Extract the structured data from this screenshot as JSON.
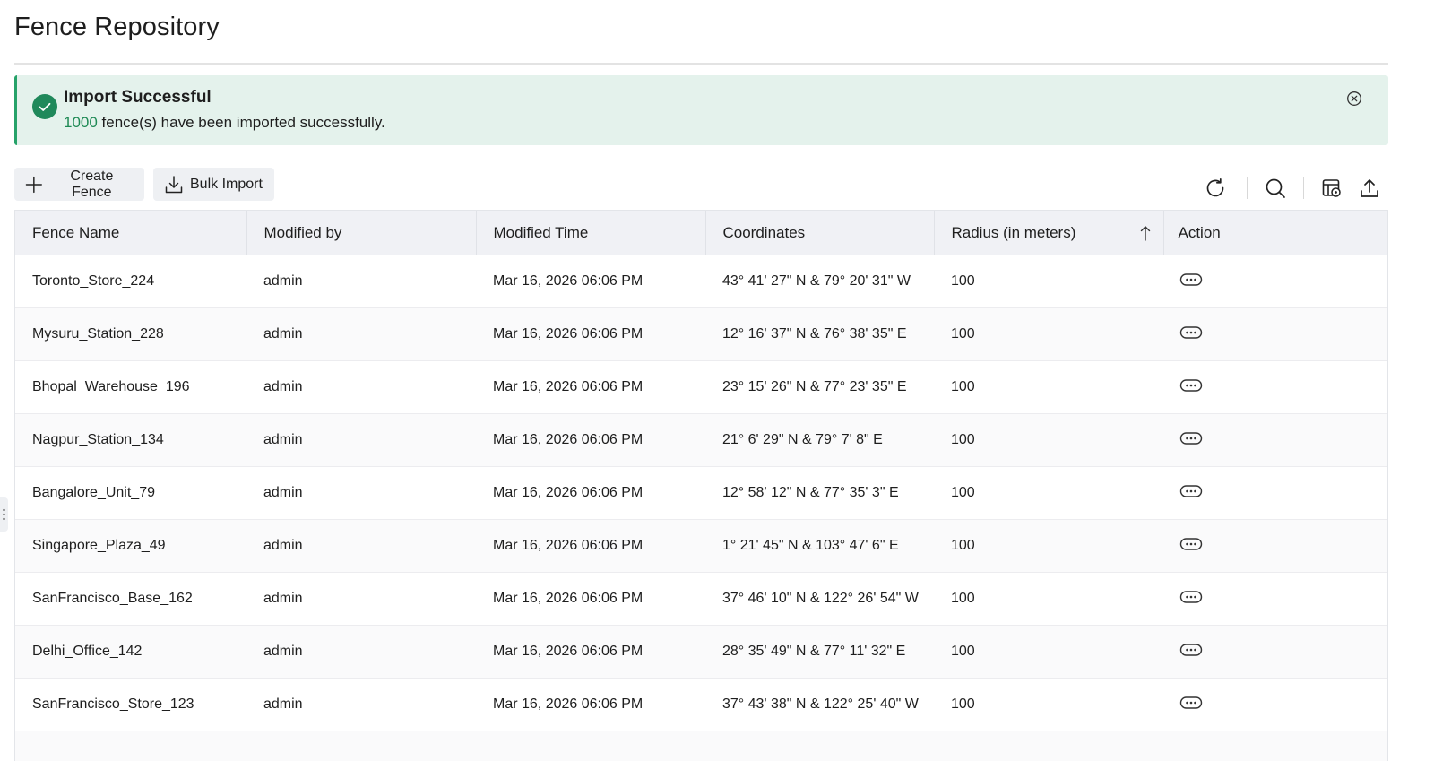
{
  "page": {
    "title": "Fence Repository"
  },
  "banner": {
    "title": "Import Successful",
    "count": "1000",
    "message": " fence(s) have been imported successfully.",
    "icon": "check-circle-icon",
    "close_icon": "close-circle-icon"
  },
  "toolbar": {
    "create_label": "Create Fence",
    "import_label": "Bulk Import",
    "icons": [
      "refresh-icon",
      "search-icon",
      "table-settings-icon",
      "export-icon"
    ]
  },
  "table": {
    "columns": [
      "Fence Name",
      "Modified by",
      "Modified Time",
      "Coordinates",
      "Radius (in meters)",
      "Action"
    ],
    "sorted_column": "Radius (in meters)",
    "sort_direction": "ascending",
    "rows": [
      {
        "name": "Toronto_Store_224",
        "modified_by": "admin",
        "modified_time": "Mar 16, 2026 06:06 PM",
        "coordinates": "43° 41' 27\" N & 79° 20' 31\" W",
        "radius": "100"
      },
      {
        "name": "Mysuru_Station_228",
        "modified_by": "admin",
        "modified_time": "Mar 16, 2026 06:06 PM",
        "coordinates": "12° 16' 37\" N & 76° 38' 35\" E",
        "radius": "100"
      },
      {
        "name": "Bhopal_Warehouse_196",
        "modified_by": "admin",
        "modified_time": "Mar 16, 2026 06:06 PM",
        "coordinates": "23° 15' 26\" N & 77° 23' 35\" E",
        "radius": "100"
      },
      {
        "name": "Nagpur_Station_134",
        "modified_by": "admin",
        "modified_time": "Mar 16, 2026 06:06 PM",
        "coordinates": "21° 6' 29\" N & 79° 7' 8\" E",
        "radius": "100"
      },
      {
        "name": "Bangalore_Unit_79",
        "modified_by": "admin",
        "modified_time": "Mar 16, 2026 06:06 PM",
        "coordinates": "12° 58' 12\" N & 77° 35' 3\" E",
        "radius": "100"
      },
      {
        "name": "Singapore_Plaza_49",
        "modified_by": "admin",
        "modified_time": "Mar 16, 2026 06:06 PM",
        "coordinates": "1° 21' 45\" N & 103° 47' 6\" E",
        "radius": "100"
      },
      {
        "name": "SanFrancisco_Base_162",
        "modified_by": "admin",
        "modified_time": "Mar 16, 2026 06:06 PM",
        "coordinates": "37° 46' 10\" N & 122° 26' 54\" W",
        "radius": "100"
      },
      {
        "name": "Delhi_Office_142",
        "modified_by": "admin",
        "modified_time": "Mar 16, 2026 06:06 PM",
        "coordinates": "28° 35' 49\" N & 77° 11' 32\" E",
        "radius": "100"
      },
      {
        "name": "SanFrancisco_Store_123",
        "modified_by": "admin",
        "modified_time": "Mar 16, 2026 06:06 PM",
        "coordinates": "37° 43' 38\" N & 122° 25' 40\" W",
        "radius": "100"
      },
      {
        "name": "",
        "modified_by": "",
        "modified_time": "",
        "coordinates": "",
        "radius": ""
      }
    ],
    "action_icon": "more-options-icon"
  },
  "colors": {
    "success_bg": "#e4f2ec",
    "success_accent": "#20895b",
    "count_text": "#1f8a55",
    "button_bg": "#eef0f3",
    "header_bg": "#f0f1f5"
  }
}
